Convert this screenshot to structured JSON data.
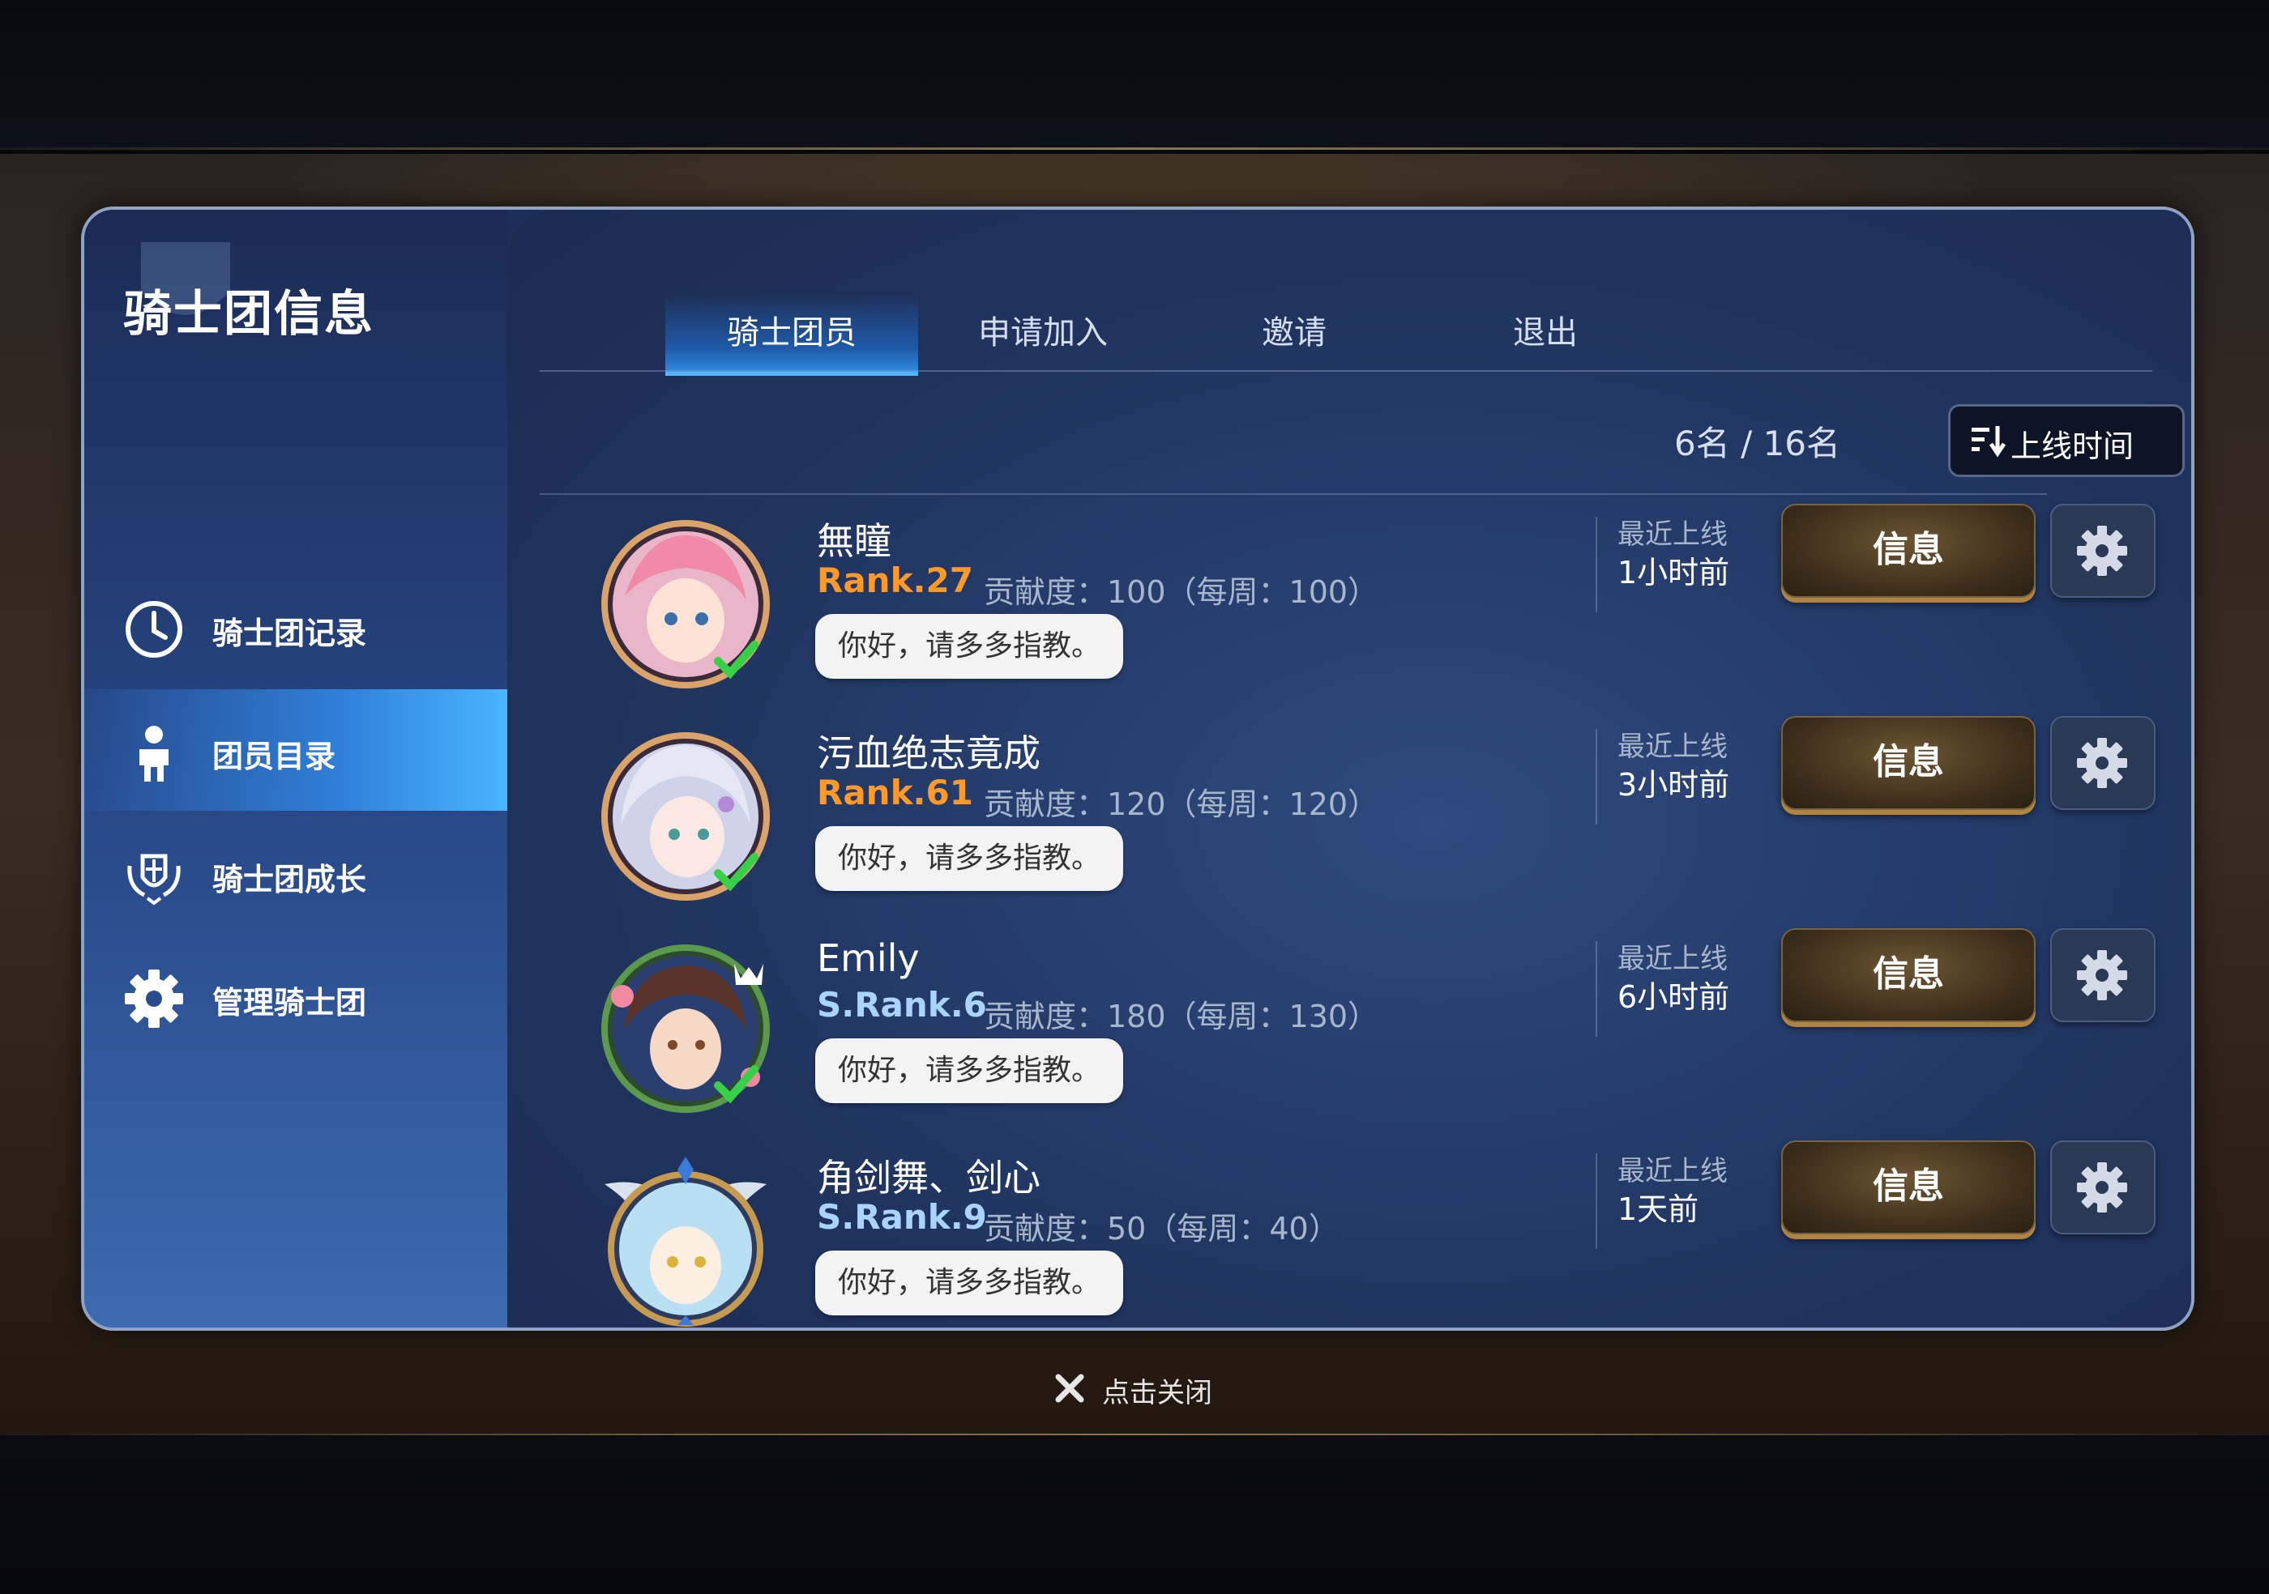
{
  "sidebar": {
    "title": "骑士团信息",
    "items": [
      {
        "label": "骑士团记录",
        "icon": "clock-icon",
        "active": false
      },
      {
        "label": "团员目录",
        "icon": "person-icon",
        "active": true
      },
      {
        "label": "骑士团成长",
        "icon": "crest-icon",
        "active": false
      },
      {
        "label": "管理骑士团",
        "icon": "gear-icon",
        "active": false
      }
    ]
  },
  "tabs": [
    {
      "label": "骑士团员",
      "active": true
    },
    {
      "label": "申请加入",
      "active": false
    },
    {
      "label": "邀请",
      "active": false
    },
    {
      "label": "退出",
      "active": false
    }
  ],
  "member_count": "6名 / 16名",
  "sort": {
    "label": "上线时间",
    "icon": "sort-icon"
  },
  "members": [
    {
      "name": "無瞳",
      "rank": "Rank.27",
      "rank_type": "normal",
      "contribution": "贡献度：100（每周：100）",
      "greeting": "你好，请多多指教。",
      "online_label": "最近上线",
      "online_time": "1小时前",
      "info_label": "信息"
    },
    {
      "name": "污血绝志竟成",
      "rank": "Rank.61",
      "rank_type": "normal",
      "contribution": "贡献度：120（每周：120）",
      "greeting": "你好，请多多指教。",
      "online_label": "最近上线",
      "online_time": "3小时前",
      "info_label": "信息"
    },
    {
      "name": "Emily",
      "rank": "S.Rank.6",
      "rank_type": "special",
      "contribution": "贡献度：180（每周：130）",
      "greeting": "你好，请多多指教。",
      "online_label": "最近上线",
      "online_time": "6小时前",
      "info_label": "信息"
    },
    {
      "name": "角剑舞、剑心",
      "rank": "S.Rank.9",
      "rank_type": "special",
      "contribution": "贡献度：50（每周：40）",
      "greeting": "你好，请多多指教。",
      "online_label": "最近上线",
      "online_time": "1天前",
      "info_label": "信息"
    }
  ],
  "close_hint": "点击关闭",
  "colors": {
    "accent_blue": "#49b5ff",
    "rank_orange": "#ff9a2a",
    "rank_special": "#a9d4ff",
    "gold": "#b08440"
  }
}
